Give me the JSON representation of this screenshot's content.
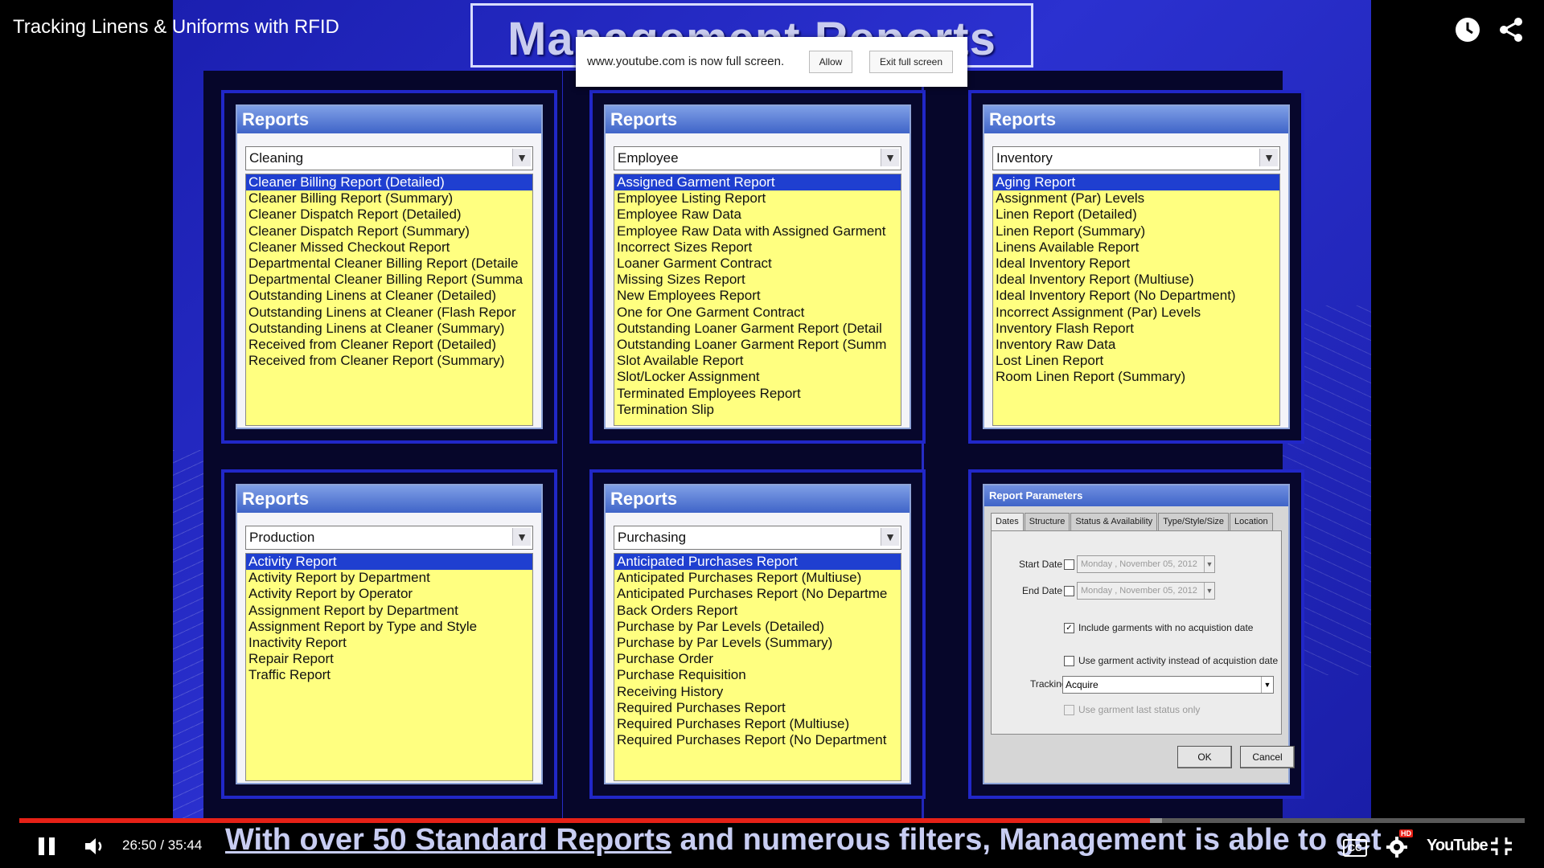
{
  "video": {
    "title": "Tracking Linens & Uniforms with RFID",
    "time_current": "26:50",
    "time_sep": "/",
    "time_total": "35:44",
    "progress": 0.751,
    "buffered": 0.759,
    "hd_badge": "HD",
    "cc_label": "CC",
    "logo_text": "YouTube"
  },
  "fullscreen_notice": {
    "text": "www.youtube.com is now full screen.",
    "allow": "Allow",
    "exit": "Exit full screen"
  },
  "slide": {
    "title": "Management Reports",
    "caption_underlined": "With over 50 Standard Reports",
    "caption_rest": " and numerous filters, Management is able to get"
  },
  "panels": [
    {
      "title": "Reports",
      "category": "Cleaning",
      "selected_index": 0,
      "items": [
        "Cleaner Billing Report (Detailed)",
        "Cleaner Billing Report (Summary)",
        "Cleaner Dispatch Report (Detailed)",
        "Cleaner Dispatch Report (Summary)",
        "Cleaner Missed Checkout Report",
        "Departmental Cleaner Billing Report (Detaile",
        "Departmental Cleaner Billing Report (Summa",
        "Outstanding Linens at Cleaner (Detailed)",
        "Outstanding Linens at Cleaner (Flash Repor",
        "Outstanding Linens at Cleaner (Summary)",
        "Received from Cleaner Report (Detailed)",
        "Received from Cleaner Report (Summary)"
      ]
    },
    {
      "title": "Reports",
      "category": "Employee",
      "selected_index": 0,
      "items": [
        "Assigned Garment Report",
        "Employee Listing Report",
        "Employee Raw Data",
        "Employee Raw Data with Assigned Garment",
        "Incorrect Sizes Report",
        "Loaner Garment Contract",
        "Missing Sizes Report",
        "New Employees Report",
        "One for One Garment Contract",
        "Outstanding Loaner Garment Report (Detail",
        "Outstanding Loaner Garment Report (Summ",
        "Slot Available Report",
        "Slot/Locker Assignment",
        "Terminated Employees Report",
        "Termination Slip"
      ]
    },
    {
      "title": "Reports",
      "category": "Inventory",
      "selected_index": 0,
      "items": [
        "Aging Report",
        "Assignment (Par) Levels",
        "Linen Report (Detailed)",
        "Linen Report (Summary)",
        "Linens Available Report",
        "Ideal Inventory Report",
        "Ideal Inventory Report (Multiuse)",
        "Ideal Inventory Report (No Department)",
        "Incorrect Assignment (Par) Levels",
        "Inventory Flash Report",
        "Inventory Raw Data",
        "Lost Linen Report",
        "Room Linen Report (Summary)"
      ]
    },
    {
      "title": "Reports",
      "category": "Production",
      "selected_index": 0,
      "items": [
        "Activity Report",
        "Activity Report by Department",
        "Activity Report by Operator",
        "Assignment Report by Department",
        "Assignment Report by Type and Style",
        "Inactivity Report",
        "Repair Report",
        "Traffic Report"
      ]
    },
    {
      "title": "Reports",
      "category": "Purchasing",
      "selected_index": 0,
      "items": [
        "Anticipated Purchases Report",
        "Anticipated Purchases Report (Multiuse)",
        "Anticipated Purchases Report (No Departme",
        "Back Orders Report",
        "Purchase by Par Levels (Detailed)",
        "Purchase by Par Levels (Summary)",
        "Purchase Order",
        "Purchase Requisition",
        "Receiving History",
        "Required Purchases Report",
        "Required Purchases Report (Multiuse)",
        "Required Purchases Report (No Department"
      ]
    }
  ],
  "dialog": {
    "title": "Report Parameters",
    "tabs": [
      "Dates",
      "Structure",
      "Status & Availability",
      "Type/Style/Size",
      "Location"
    ],
    "start_label": "Start Date",
    "end_label": "End Date",
    "start_value": "Monday , November 05, 2012",
    "end_value": "Monday , November 05, 2012",
    "opt1": "Include garments with no acquistion date",
    "opt1_checked": true,
    "opt2": "Use garment activity instead of acquistion date",
    "tracking_label": "Tracking",
    "tracking_value": "Acquire",
    "opt3": "Use garment last status only",
    "ok": "OK",
    "cancel": "Cancel"
  }
}
